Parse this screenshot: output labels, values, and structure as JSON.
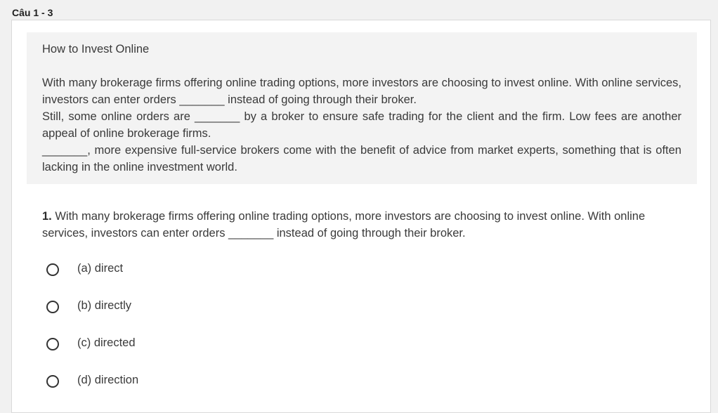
{
  "header": {
    "label": "Câu 1 - 3"
  },
  "passage": {
    "title": "How to Invest Online",
    "paragraphs": [
      "With many brokerage firms offering online trading options, more investors are choosing to invest online. With online services, investors can enter orders _______ instead of going through their broker.",
      "Still, some online orders are _______ by a broker to ensure safe trading for the client and the firm. Low fees are another appeal of online brokerage firms.",
      "_______, more expensive full-service brokers come with the benefit of advice from market experts, something that is often lacking in the online investment world."
    ]
  },
  "question": {
    "number": "1.",
    "text": "With many brokerage firms offering online trading options, more investors are choosing to invest online. With online services, investors can enter orders _______ instead of going through their broker.",
    "options": [
      {
        "label": "(a) direct"
      },
      {
        "label": "(b) directly"
      },
      {
        "label": "(c) directed"
      },
      {
        "label": "(d) direction"
      }
    ]
  }
}
